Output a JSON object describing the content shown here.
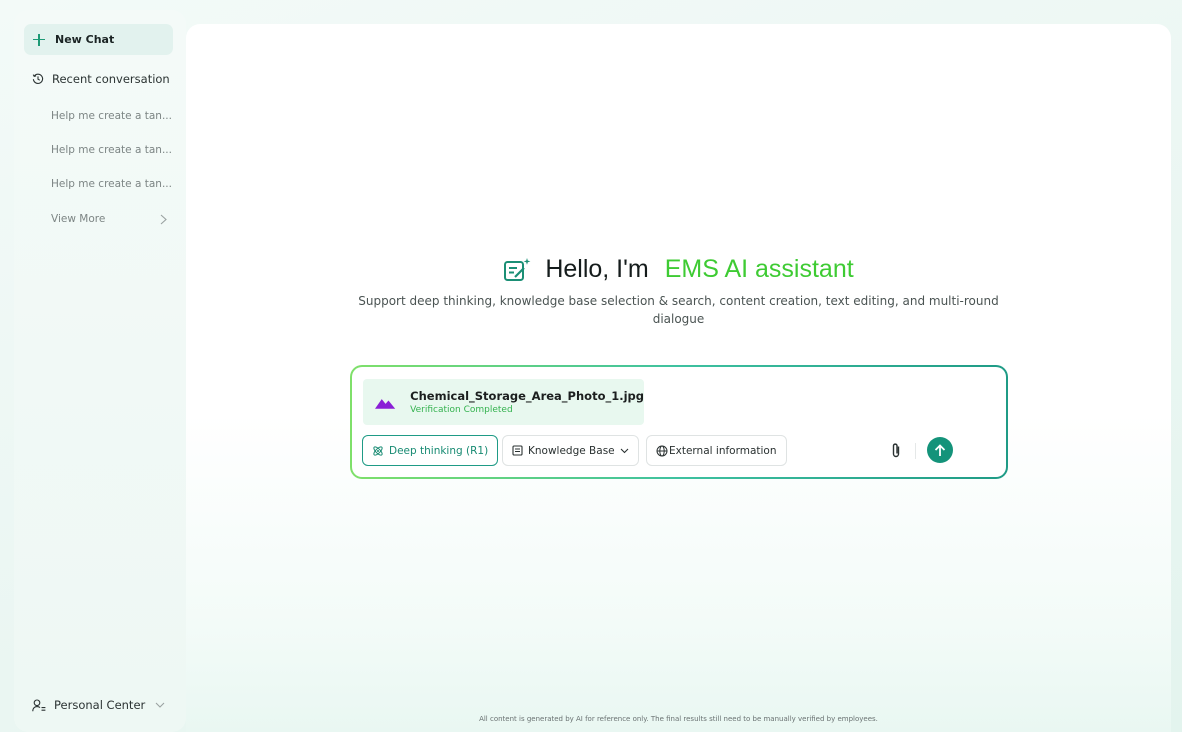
{
  "sidebar": {
    "new_chat": "New Chat",
    "recent_header": "Recent conversation",
    "history": [
      "Help me create a tan...",
      "Help me create a tan...",
      "Help me create a tan..."
    ],
    "view_more": "View More",
    "personal_center": "Personal Center"
  },
  "hero": {
    "greeting": "Hello, I'm",
    "brand": "EMS AI assistant",
    "subtitle": "Support deep thinking, knowledge base selection & search, content creation, text editing, and multi-round dialogue"
  },
  "composer": {
    "attachment": {
      "file_name": "Chemical_Storage_Area_Photo_1.jpg",
      "status": "Verification Completed"
    },
    "chips": {
      "deep_thinking": "Deep thinking (R1)",
      "knowledge_base": "Knowledge Base",
      "external_info": "External information"
    }
  },
  "footer": {
    "disclaimer": "All content is generated by AI for reference only. The final results still need to be manually verified by employees."
  },
  "colors": {
    "accent": "#14937a",
    "brand_green": "#3ecb33",
    "status_green": "#34b24f",
    "file_icon_purple": "#8a1fd6"
  }
}
